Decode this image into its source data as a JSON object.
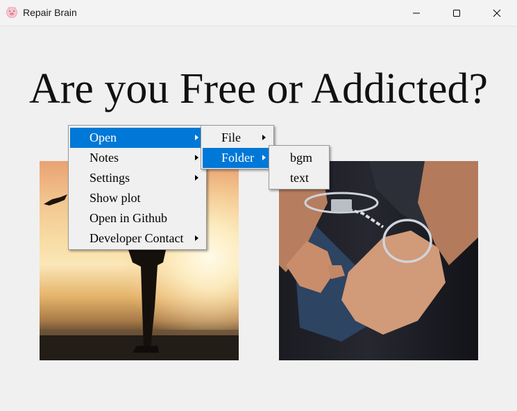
{
  "window": {
    "title": "Repair Brain",
    "app_icon": "pig-face-icon",
    "controls": [
      "minimize-icon",
      "maximize-icon",
      "close-icon"
    ]
  },
  "heading": "Are you Free or Addicted?",
  "images": [
    {
      "name": "silhouette-sunset-photo"
    },
    {
      "name": "handcuffed-hands-photo"
    }
  ],
  "context_menu": {
    "items": [
      {
        "label": "Open",
        "has_submenu": true,
        "highlighted": true
      },
      {
        "label": "Notes",
        "has_submenu": true
      },
      {
        "label": "Settings",
        "has_submenu": true
      },
      {
        "label": "Show plot",
        "has_submenu": false
      },
      {
        "label": "Open in Github",
        "has_submenu": false
      },
      {
        "label": "Developer Contact",
        "has_submenu": true
      }
    ],
    "open_submenu": {
      "items": [
        {
          "label": "File",
          "has_submenu": true
        },
        {
          "label": "Folder",
          "has_submenu": true,
          "highlighted": true
        }
      ]
    },
    "folder_submenu": {
      "items": [
        {
          "label": "bgm"
        },
        {
          "label": "text"
        }
      ]
    }
  },
  "colors": {
    "highlight": "#0078d7",
    "background": "#f0f0f0"
  }
}
